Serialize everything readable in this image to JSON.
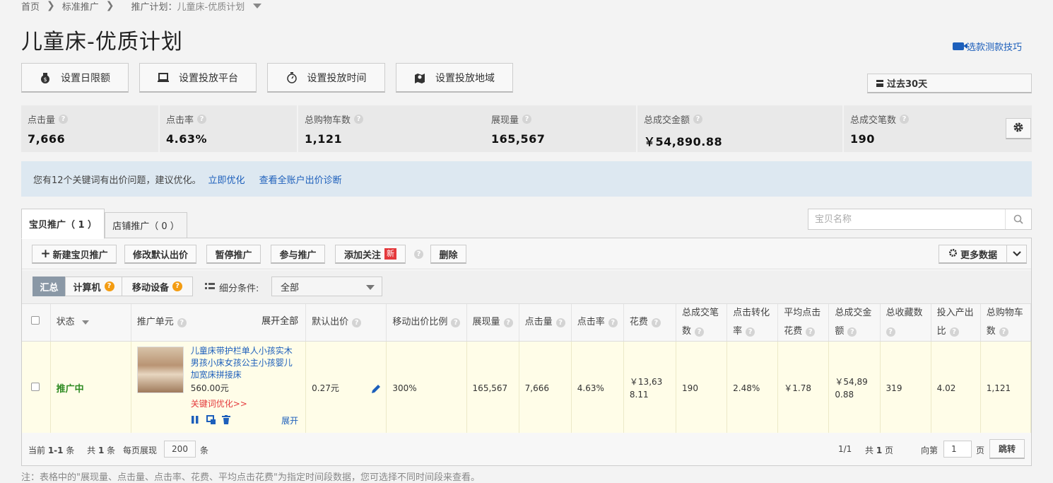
{
  "breadcrumb": {
    "home": "首页",
    "standard": "标准推广",
    "plan_prefix": "推广计划：",
    "plan_name": "儿童床-优质计划"
  },
  "page_title": "儿童床-优质计划",
  "video_tip": "选款测款技巧",
  "setting_buttons": {
    "budget": "设置日限额",
    "platform": "设置投放平台",
    "time": "设置投放时间",
    "region": "设置投放地域"
  },
  "date_range": "过去30天",
  "metrics": [
    {
      "label": "点击量",
      "value": "7,666"
    },
    {
      "label": "点击率",
      "value": "4.63%"
    },
    {
      "label": "总购物车数",
      "value": "1,121"
    },
    {
      "label": "展现量",
      "value": "165,567"
    },
    {
      "label": "总成交金额",
      "value": "￥54,890.88"
    },
    {
      "label": "总成交笔数",
      "value": "190"
    }
  ],
  "notice": {
    "text": "您有12个关键词有出价问题，建议优化。",
    "link1": "立即优化",
    "link2": "查看全账户出价诊断"
  },
  "tabs": {
    "items": "宝贝推广（ 1 ）",
    "shop": "店铺推广（ 0 ）"
  },
  "search": {
    "placeholder": "宝贝名称"
  },
  "toolbar": {
    "new": "新建宝贝推广",
    "modify_bid": "修改默认出价",
    "pause": "暂停推广",
    "join": "参与推广",
    "follow": "添加关注",
    "new_badge": "新",
    "delete": "删除",
    "more_data": "更多数据"
  },
  "filter": {
    "summary": "汇总",
    "computer": "计算机",
    "mobile": "移动设备",
    "condition_label": "细分条件:",
    "condition_value": "全部"
  },
  "columns": {
    "status": "状态",
    "unit": "推广单元",
    "expand_all": "展开全部",
    "bid": "默认出价",
    "mobile_ratio": "移动出价比例",
    "impressions": "展现量",
    "clicks": "点击量",
    "ctr": "点击率",
    "cost": "花费",
    "orders_a": "总成交笔",
    "orders_b": "数",
    "cvr_a": "点击转化",
    "cvr_b": "率",
    "cpc_a": "平均点击",
    "cpc_b": "花费",
    "gmv_a": "总成交金",
    "gmv_b": "额",
    "fav": "总收藏数",
    "roi_a": "投入产出",
    "roi_b": "比",
    "cart_a": "总购物车",
    "cart_b": "数"
  },
  "row": {
    "status": "推广中",
    "title": "儿童床带护栏单人小孩实木男孩小床女孩公主小孩婴儿加宽床拼接床",
    "price": "560.00元",
    "kw_opt": "关键词优化>>",
    "expand": "展开",
    "bid": "0.27元",
    "mobile_ratio": "300%",
    "impressions": "165,567",
    "clicks": "7,666",
    "ctr": "4.63%",
    "cost_a": "￥13,63",
    "cost_b": "8.11",
    "orders": "190",
    "cvr": "2.48%",
    "cpc": "￥1.78",
    "gmv_a": "￥54,89",
    "gmv_b": "0.88",
    "fav": "319",
    "roi": "4.02",
    "cart": "1,121"
  },
  "footer": {
    "current": "当前 ",
    "range": "1-1",
    "unit_tiao": " 条",
    "total_pre": "共 ",
    "total": "1",
    "per_page_label": "每页展现",
    "per_page": "200",
    "pages": "1/1",
    "total_pages_pre": "共 ",
    "total_pages": "1",
    "page_unit": " 页",
    "goto_pre": "向第",
    "goto_val": "1",
    "goto_unit": "页",
    "goto_btn": "跳转"
  },
  "footnote": "注：表格中的\"展现量、点击量、点击率、花费、平均点击花费\"为指定时间段数据，您可选择不同时间段来查看。"
}
